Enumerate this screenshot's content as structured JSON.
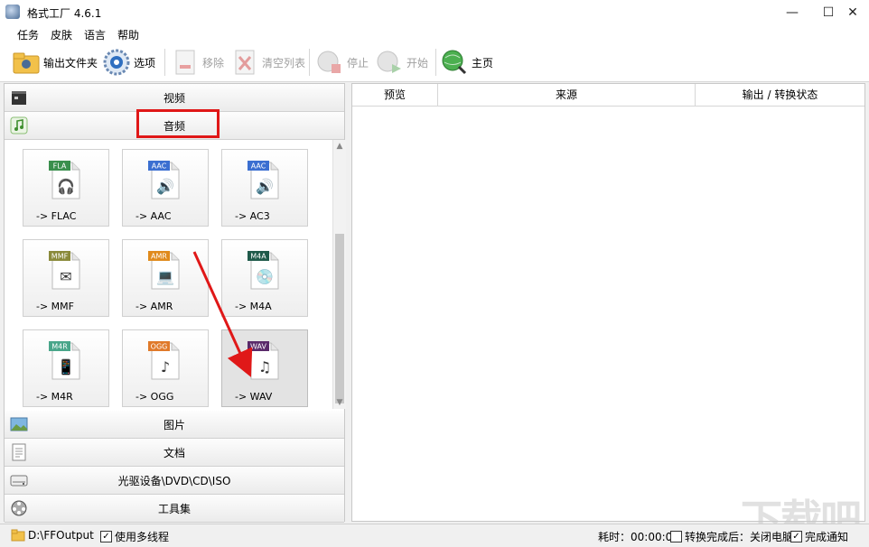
{
  "window": {
    "title": "格式工厂 4.6.1",
    "min": "—",
    "max": "☐",
    "close": "✕"
  },
  "menu": [
    "任务",
    "皮肤",
    "语言",
    "帮助"
  ],
  "toolbar": {
    "output_folder": "输出文件夹",
    "options": "选项",
    "remove": "移除",
    "clear_list": "清空列表",
    "stop": "停止",
    "start": "开始",
    "home": "主页"
  },
  "categories": {
    "video": "视频",
    "audio": "音频",
    "picture": "图片",
    "document": "文档",
    "rom": "光驱设备\\DVD\\CD\\ISO",
    "tools": "工具集"
  },
  "formats": [
    {
      "badge": "FLA",
      "label": "-> FLAC",
      "badge_color": "#3a8f4d",
      "glyph": "🎧"
    },
    {
      "badge": "AAC",
      "label": "-> AAC",
      "badge_color": "#3b6fd1",
      "glyph": "🔊"
    },
    {
      "badge": "AAC",
      "label": "-> AC3",
      "badge_color": "#3b6fd1",
      "glyph": "🔊"
    },
    {
      "badge": "MMF",
      "label": "-> MMF",
      "badge_color": "#8a8a3a",
      "glyph": "✉"
    },
    {
      "badge": "AMR",
      "label": "-> AMR",
      "badge_color": "#e08a1c",
      "glyph": "💻"
    },
    {
      "badge": "M4A",
      "label": "-> M4A",
      "badge_color": "#1f5a4a",
      "glyph": "💿"
    },
    {
      "badge": "M4R",
      "label": "-> M4R",
      "badge_color": "#49a68a",
      "glyph": "📱"
    },
    {
      "badge": "OGG",
      "label": "-> OGG",
      "badge_color": "#e07a2a",
      "glyph": "♪"
    },
    {
      "badge": "WAV",
      "label": "-> WAV",
      "badge_color": "#5a2a6a",
      "glyph": "♫"
    }
  ],
  "list_columns": [
    "预览",
    "来源",
    "输出 / 转换状态"
  ],
  "status": {
    "output_path": "D:\\FFOutput",
    "multithread": "使用多线程",
    "elapsed": "耗时：00:00:00",
    "after_convert": "转换完成后：关闭电脑",
    "notify": "完成通知"
  },
  "colors": {
    "highlight": "#e01818",
    "arrow": "#e01818"
  }
}
